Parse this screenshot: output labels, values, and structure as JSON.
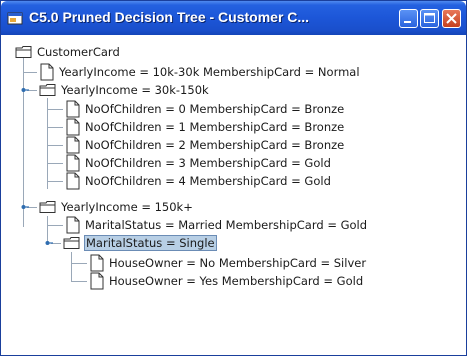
{
  "window": {
    "title": "C5.0 Pruned Decision Tree - Customer C...",
    "colors": {
      "titlebar": "#1c56d8",
      "selection": "#b8cfe5"
    }
  },
  "tree": {
    "root": "CustomerCard",
    "n1": "YearlyIncome = 10k-30k MembershipCard = Normal",
    "n2": "YearlyIncome = 30k-150k",
    "n2_1": "NoOfChildren = 0 MembershipCard = Bronze",
    "n2_2": "NoOfChildren = 1 MembershipCard = Bronze",
    "n2_3": "NoOfChildren = 2 MembershipCard = Bronze",
    "n2_4": "NoOfChildren = 3 MembershipCard = Gold",
    "n2_5": "NoOfChildren = 4 MembershipCard = Gold",
    "n3": "YearlyIncome = 150k+",
    "n3_1": "MaritalStatus = Married MembershipCard = Gold",
    "n3_2": "MaritalStatus = Single",
    "n3_2_1": "HouseOwner = No MembershipCard = Silver",
    "n3_2_2": "HouseOwner = Yes MembershipCard = Gold"
  }
}
